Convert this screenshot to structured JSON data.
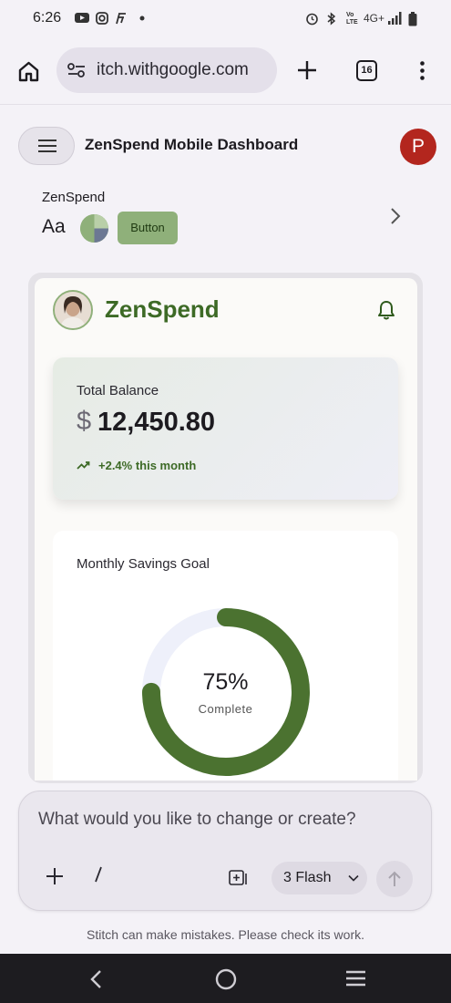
{
  "status_bar": {
    "time": "6:26",
    "network": "4G+"
  },
  "browser": {
    "url": "itch.withgoogle.com",
    "tab_count": "16"
  },
  "app_header": {
    "title": "ZenSpend Mobile Dashboard",
    "avatar_letter": "P"
  },
  "theme": {
    "name": "ZenSpend",
    "font_sample": "Aa",
    "button_label": "Button",
    "primary_color": "#8fb07a"
  },
  "preview": {
    "app_name": "ZenSpend",
    "balance": {
      "label": "Total Balance",
      "currency": "$",
      "amount": "12,450.80",
      "trend": "+2.4% this month"
    },
    "savings": {
      "label": "Monthly Savings Goal",
      "percent_text": "75%",
      "status": "Complete",
      "progress": 0.75
    },
    "accent_color": "#3d6a26"
  },
  "prompt": {
    "placeholder": "What would you like to change or create?",
    "model": "3 Flash"
  },
  "disclaimer": "Stitch can make mistakes. Please check its work."
}
